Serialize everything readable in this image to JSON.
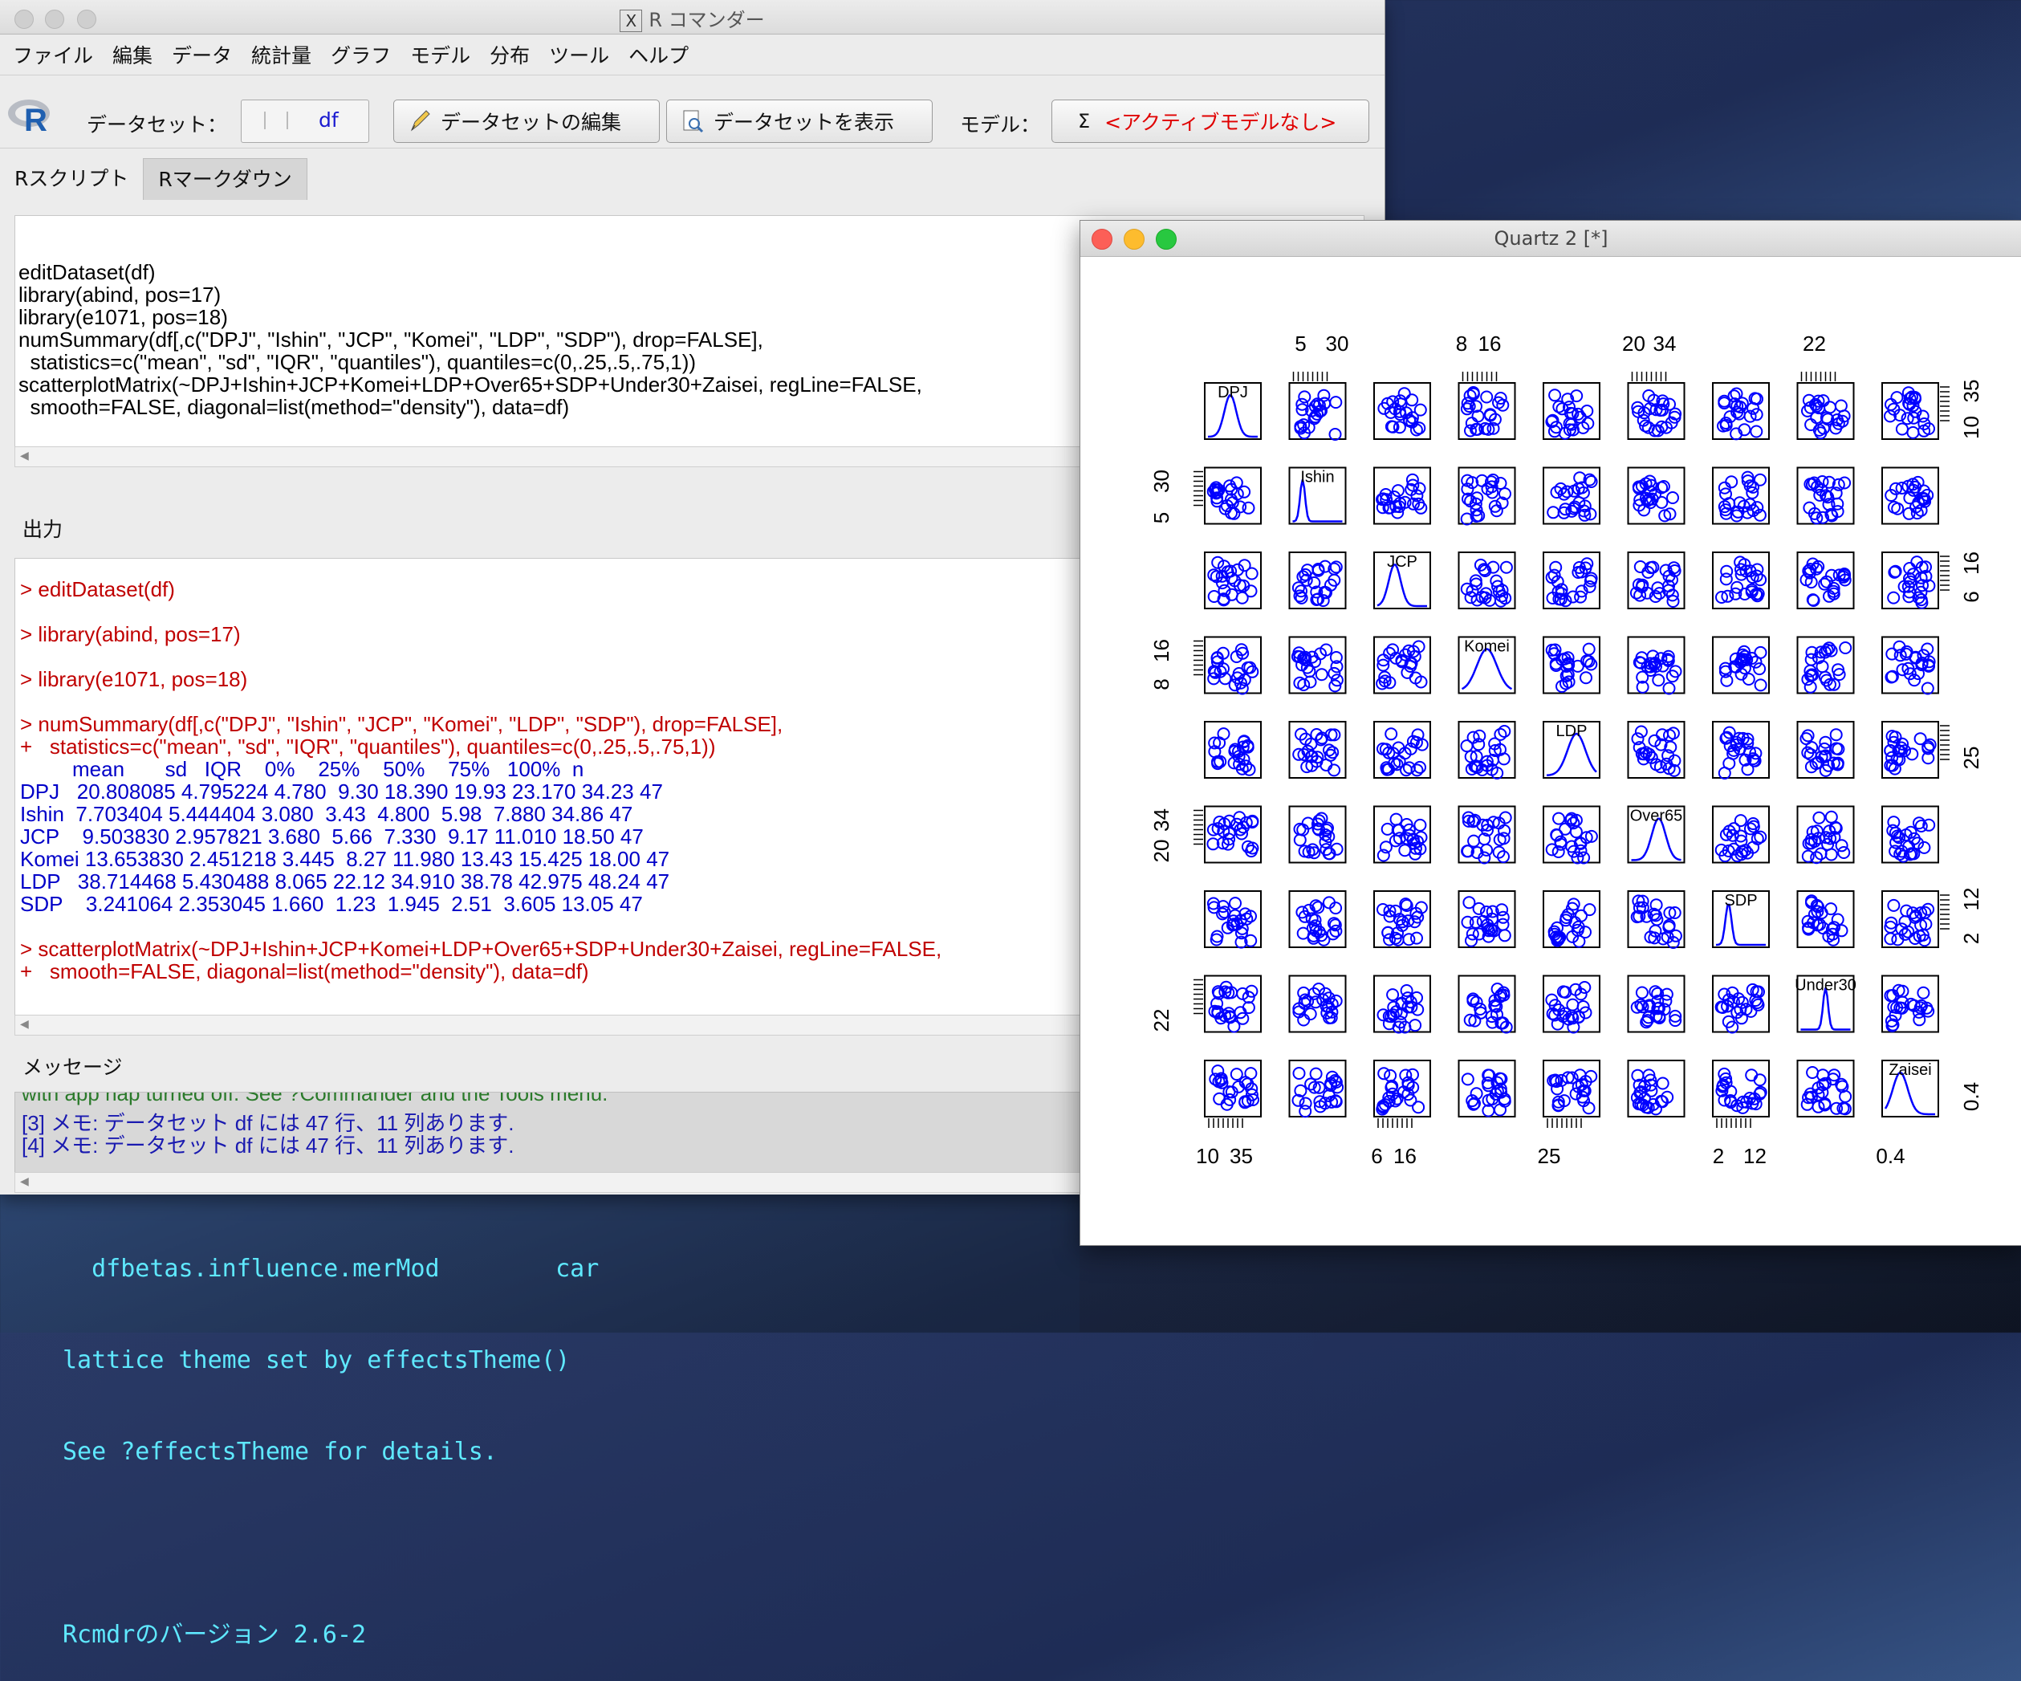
{
  "rcmdr": {
    "title": "R コマンダー",
    "menu": [
      "ファイル",
      "編集",
      "データ",
      "統計量",
      "グラフ",
      "モデル",
      "分布",
      "ツール",
      "ヘルプ"
    ],
    "toolbar": {
      "dataset_label": "データセット：",
      "dataset_value": "df",
      "edit_dataset": "データセットの編集",
      "view_dataset": "データセットを表示",
      "model_label": "モデル：",
      "model_value": "<アクティブモデルなし>"
    },
    "tabs": [
      "Rスクリプト",
      "Rマークダウン"
    ],
    "script": "\neditDataset(df)\nlibrary(abind, pos=17)\nlibrary(e1071, pos=18)\nnumSummary(df[,c(\"DPJ\", \"Ishin\", \"JCP\", \"Komei\", \"LDP\", \"SDP\"), drop=FALSE],\n  statistics=c(\"mean\", \"sd\", \"IQR\", \"quantiles\"), quantiles=c(0,.25,.5,.75,1))\nscatterplotMatrix(~DPJ+Ishin+JCP+Komei+LDP+Over65+SDP+Under30+Zaisei, regLine=FALSE,\n  smooth=FALSE, diagonal=list(method=\"density\"), data=df)",
    "output_label": "出力",
    "output_red": [
      "> editDataset(df)",
      "> library(abind, pos=17)",
      "> library(e1071, pos=18)",
      "> numSummary(df[,c(\"DPJ\", \"Ishin\", \"JCP\", \"Komei\", \"LDP\", \"SDP\"), drop=FALSE],",
      "+   statistics=c(\"mean\", \"sd\", \"IQR\", \"quantiles\"), quantiles=c(0,.25,.5,.75,1))",
      "> scatterplotMatrix(~DPJ+Ishin+JCP+Komei+LDP+Over65+SDP+Under30+Zaisei, regLine=FALSE,",
      "+   smooth=FALSE, diagonal=list(method=\"density\"), data=df)"
    ],
    "output_table": "         mean       sd   IQR    0%    25%    50%    75%   100%  n\nDPJ   20.808085 4.795224 4.780  9.30 18.390 19.93 23.170 34.23 47\nIshin  7.703404 5.444404 3.080  3.43  4.800  5.98  7.880 34.86 47\nJCP    9.503830 2.957821 3.680  5.66  7.330  9.17 11.010 18.50 47\nKomei 13.653830 2.451218 3.445  8.27 11.980 13.43 15.425 18.00 47\nLDP   38.714468 5.430488 8.065 22.12 34.910 38.78 42.975 48.24 47\nSDP    3.241064 2.353045 1.660  1.23  1.945  2.51  3.605 13.05 47",
    "message_label": "メッセージ",
    "message_clipped": "with app nap turned off. See ?Commander and the Tools menu.",
    "messages": [
      "[3] メモ: データセット df には 47 行、11 列あります.",
      "[4] メモ: データセット df には 47 行、11 列あります."
    ]
  },
  "terminal": {
    "lines": [
      "  dfbetas.influence.merMod        car",
      "lattice theme set by effectsTheme()",
      "See ?effectsTheme for details.",
      "",
      "Rcmdrのバージョン 2.6-2"
    ]
  },
  "quartz": {
    "title": "Quartz 2 [*]",
    "point_color": "#0000ff",
    "variables": [
      "DPJ",
      "Ishin",
      "JCP",
      "Komei",
      "LDP",
      "Over65",
      "SDP",
      "Under30",
      "Zaisei"
    ],
    "diag_labels": [
      "DPJ",
      "Ishin",
      "JCP",
      "Komei",
      "LDP",
      "Over65",
      "SDP",
      "Under30",
      "Zaisei"
    ],
    "top_axis": [
      "5",
      "30",
      "8",
      "16",
      "20",
      "34",
      "22"
    ],
    "bottom_axis": [
      "10",
      "35",
      "6",
      "16",
      "25",
      "2",
      "12",
      "0.4"
    ],
    "left_axis": [
      "30",
      "5",
      "16",
      "8",
      "34",
      "20",
      "22"
    ],
    "right_axis": [
      "35",
      "10",
      "16",
      "6",
      "25",
      "12",
      "2",
      "0.4"
    ]
  }
}
